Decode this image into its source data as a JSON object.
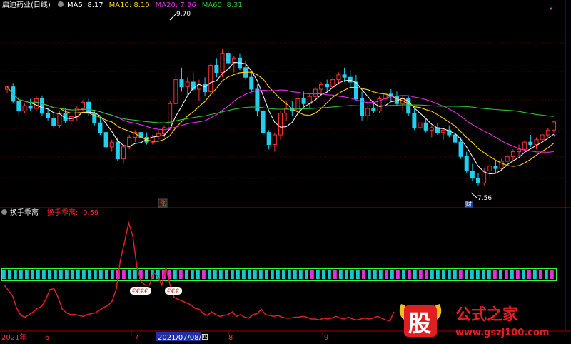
{
  "colors": {
    "background": "#000000",
    "grid": "#7a0000",
    "up": "#ff3030",
    "down": "#20d0f0",
    "ma5": "#f0f0f0",
    "ma10": "#ffd000",
    "ma20": "#e030e0",
    "ma60": "#30c030",
    "indicator_line": "#e02020",
    "band_border": "#30ff30",
    "band_cyan": "#18c8c8",
    "band_magenta": "#e030e0",
    "watermark_red": "#e02020",
    "watermark_gold": "#f0c020"
  },
  "header": {
    "stock_name": "启迪药业(日线)",
    "ma5": "MA5: 8.17",
    "ma10": "MA10: 8.10",
    "ma20": "MA20: 7.96",
    "ma60": "MA60: 8.31"
  },
  "indicator_header": {
    "name": "换手乖离",
    "value_label": "换手乖离: -0.59"
  },
  "price_annotations": {
    "high": "9.70",
    "low": "7.56",
    "event_top": "涨",
    "event_bottom": "财"
  },
  "signal_labels": [
    "€€€€",
    "€€€"
  ],
  "x_axis": {
    "ticks": [
      "2021年",
      "6",
      "7",
      "2021/07/08/四",
      "8",
      "9"
    ]
  },
  "watermark": {
    "char": "股",
    "brand": "公式之家",
    "url": "www.gszj100.com"
  },
  "chart_data": [
    {
      "type": "candlestick",
      "title": "启迪药业(日线)",
      "ylim": [
        6.4,
        10.5
      ],
      "series_names": [
        "MA5",
        "MA10",
        "MA20",
        "MA60"
      ],
      "ohlc": [
        [
          8.85,
          8.92,
          8.78,
          8.9
        ],
        [
          8.9,
          8.98,
          8.55,
          8.6
        ],
        [
          8.6,
          8.7,
          8.3,
          8.4
        ],
        [
          8.4,
          8.55,
          8.35,
          8.5
        ],
        [
          8.5,
          8.65,
          8.4,
          8.45
        ],
        [
          8.45,
          8.7,
          8.4,
          8.65
        ],
        [
          8.65,
          8.72,
          8.3,
          8.35
        ],
        [
          8.35,
          8.45,
          8.2,
          8.25
        ],
        [
          8.25,
          8.35,
          8.05,
          8.1
        ],
        [
          8.1,
          8.4,
          8.05,
          8.35
        ],
        [
          8.35,
          8.45,
          8.15,
          8.2
        ],
        [
          8.2,
          8.3,
          8.1,
          8.28
        ],
        [
          8.28,
          8.5,
          8.2,
          8.45
        ],
        [
          8.45,
          8.62,
          8.4,
          8.58
        ],
        [
          8.58,
          8.65,
          8.3,
          8.35
        ],
        [
          8.35,
          8.4,
          8.1,
          8.15
        ],
        [
          8.15,
          8.25,
          7.9,
          7.95
        ],
        [
          7.95,
          8.0,
          7.6,
          7.65
        ],
        [
          7.65,
          7.8,
          7.55,
          7.75
        ],
        [
          7.75,
          7.85,
          7.35,
          7.4
        ],
        [
          7.4,
          7.7,
          7.3,
          7.65
        ],
        [
          7.65,
          7.9,
          7.6,
          7.85
        ],
        [
          7.85,
          8.0,
          7.75,
          7.95
        ],
        [
          7.95,
          8.05,
          7.8,
          7.85
        ],
        [
          7.85,
          7.95,
          7.7,
          7.75
        ],
        [
          7.75,
          7.9,
          7.7,
          7.88
        ],
        [
          7.88,
          8.0,
          7.8,
          7.92
        ],
        [
          7.92,
          8.1,
          7.85,
          8.05
        ],
        [
          8.05,
          8.6,
          8.0,
          8.55
        ],
        [
          8.55,
          9.2,
          8.5,
          9.05
        ],
        [
          9.05,
          9.3,
          8.8,
          8.9
        ],
        [
          8.9,
          9.1,
          8.7,
          9.0
        ],
        [
          9.0,
          9.2,
          8.8,
          8.85
        ],
        [
          8.85,
          9.05,
          8.6,
          8.95
        ],
        [
          8.95,
          9.1,
          8.7,
          8.8
        ],
        [
          8.8,
          9.4,
          8.75,
          9.35
        ],
        [
          9.35,
          9.5,
          9.1,
          9.2
        ],
        [
          9.2,
          9.7,
          9.1,
          9.6
        ],
        [
          9.6,
          9.65,
          9.3,
          9.4
        ],
        [
          9.4,
          9.55,
          9.2,
          9.5
        ],
        [
          9.5,
          9.6,
          9.25,
          9.3
        ],
        [
          9.3,
          9.45,
          9.05,
          9.1
        ],
        [
          9.1,
          9.2,
          8.8,
          8.85
        ],
        [
          8.85,
          8.95,
          8.3,
          8.4
        ],
        [
          8.4,
          8.5,
          7.9,
          7.95
        ],
        [
          7.95,
          8.0,
          7.6,
          7.7
        ],
        [
          7.7,
          7.95,
          7.55,
          7.9
        ],
        [
          7.9,
          8.4,
          7.8,
          8.35
        ],
        [
          8.35,
          8.6,
          8.2,
          8.45
        ],
        [
          8.45,
          8.6,
          8.3,
          8.4
        ],
        [
          8.4,
          8.7,
          8.35,
          8.65
        ],
        [
          8.65,
          8.8,
          8.5,
          8.55
        ],
        [
          8.55,
          8.75,
          8.45,
          8.7
        ],
        [
          8.7,
          8.9,
          8.6,
          8.85
        ],
        [
          8.85,
          9.0,
          8.7,
          8.95
        ],
        [
          8.95,
          9.05,
          8.8,
          8.9
        ],
        [
          8.9,
          9.1,
          8.85,
          9.05
        ],
        [
          9.05,
          9.2,
          8.95,
          9.15
        ],
        [
          9.15,
          9.3,
          9.0,
          9.1
        ],
        [
          9.1,
          9.25,
          8.9,
          9.0
        ],
        [
          9.0,
          9.15,
          8.6,
          8.65
        ],
        [
          8.65,
          8.8,
          8.2,
          8.3
        ],
        [
          8.3,
          8.5,
          8.2,
          8.45
        ],
        [
          8.45,
          8.6,
          8.35,
          8.4
        ],
        [
          8.4,
          8.7,
          8.35,
          8.65
        ],
        [
          8.65,
          8.8,
          8.55,
          8.75
        ],
        [
          8.75,
          8.85,
          8.6,
          8.7
        ],
        [
          8.7,
          8.8,
          8.5,
          8.55
        ],
        [
          8.55,
          8.7,
          8.4,
          8.65
        ],
        [
          8.65,
          8.7,
          8.3,
          8.35
        ],
        [
          8.35,
          8.45,
          8.0,
          8.05
        ],
        [
          8.05,
          8.2,
          7.9,
          8.15
        ],
        [
          8.15,
          8.25,
          7.95,
          8.0
        ],
        [
          8.0,
          8.1,
          7.85,
          8.05
        ],
        [
          8.05,
          8.15,
          7.9,
          7.95
        ],
        [
          7.95,
          8.05,
          7.8,
          8.0
        ],
        [
          8.0,
          8.1,
          7.85,
          7.9
        ],
        [
          7.9,
          8.0,
          7.7,
          7.75
        ],
        [
          7.75,
          7.85,
          7.4,
          7.45
        ],
        [
          7.45,
          7.55,
          7.1,
          7.15
        ],
        [
          7.15,
          7.3,
          6.95,
          7.0
        ],
        [
          7.0,
          7.1,
          6.85,
          6.9
        ],
        [
          6.9,
          7.2,
          6.85,
          7.15
        ],
        [
          7.15,
          7.3,
          7.0,
          7.25
        ],
        [
          7.25,
          7.35,
          7.1,
          7.2
        ],
        [
          7.2,
          7.4,
          7.15,
          7.35
        ],
        [
          7.35,
          7.5,
          7.25,
          7.45
        ],
        [
          7.45,
          7.6,
          7.35,
          7.55
        ],
        [
          7.55,
          7.7,
          7.45,
          7.6
        ],
        [
          7.6,
          7.8,
          7.55,
          7.75
        ],
        [
          7.75,
          7.9,
          7.65,
          7.7
        ],
        [
          7.7,
          7.85,
          7.6,
          7.8
        ],
        [
          7.8,
          7.95,
          7.7,
          7.9
        ],
        [
          7.9,
          8.05,
          7.85,
          8.0
        ],
        [
          8.0,
          8.2,
          7.95,
          8.17
        ]
      ]
    },
    {
      "type": "line",
      "title": "换手乖离",
      "values": [
        0.0,
        -0.06,
        -0.12,
        -0.26,
        -0.34,
        -0.36,
        -0.33,
        -0.3,
        -0.26,
        -0.24,
        -0.16,
        -0.05,
        -0.04,
        -0.14,
        -0.27,
        -0.31,
        -0.33,
        -0.33,
        -0.34,
        -0.35,
        -0.33,
        -0.32,
        -0.31,
        -0.28,
        -0.25,
        -0.23,
        -0.18,
        -0.05,
        0.28,
        0.48,
        0.7,
        0.55,
        0.2,
        0.04,
        0.0,
        0.0,
        0.14,
        0.1,
        0.0,
        0.2,
        0.0,
        -0.14,
        -0.16,
        -0.18,
        -0.2,
        -0.22,
        -0.26,
        -0.27,
        -0.32,
        -0.34,
        -0.3,
        -0.33,
        -0.35,
        -0.34,
        -0.33,
        -0.3,
        -0.35,
        -0.33,
        -0.36,
        -0.37,
        -0.33,
        -0.32,
        -0.27,
        -0.33,
        -0.34,
        -0.35,
        -0.34,
        -0.36,
        -0.37,
        -0.37,
        -0.36,
        -0.36,
        -0.35,
        -0.36,
        -0.38,
        -0.38,
        -0.39,
        -0.37,
        -0.38,
        -0.37,
        -0.35,
        -0.37,
        -0.38,
        -0.36,
        -0.38,
        -0.39,
        -0.38,
        -0.37,
        -0.38,
        -0.37,
        -0.35,
        -0.37,
        -0.39,
        -0.4,
        -0.3
      ],
      "band_pattern": "0000000000000000000011001000110100010000000000000000001000100001000101010110000010000010101010101"
    }
  ]
}
